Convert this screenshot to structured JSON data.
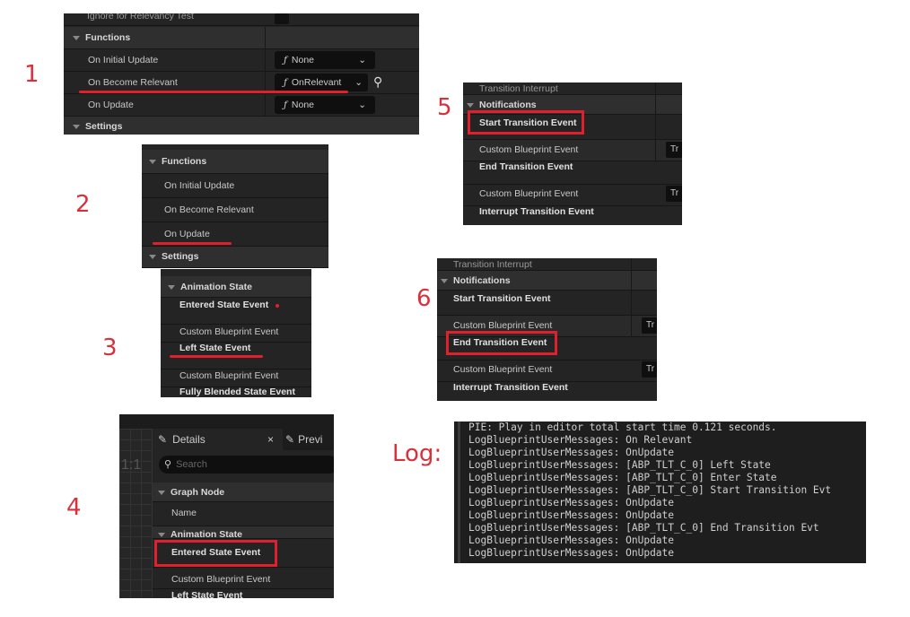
{
  "labels": {
    "p1": "1",
    "p2": "2",
    "p3": "3",
    "p4": "4",
    "p5": "5",
    "p6": "6",
    "log": "Log:"
  },
  "panel1": {
    "partial_row": "Ignore for Relevancy Test",
    "section": "Functions",
    "rows": [
      {
        "label": "On Initial Update",
        "value": "None"
      },
      {
        "label": "On Become Relevant",
        "value": "OnRelevant"
      },
      {
        "label": "On Update",
        "value": "None"
      }
    ],
    "next_section": "Settings",
    "func_icon": "ƒ"
  },
  "panel2": {
    "section": "Functions",
    "rows": [
      "On Initial Update",
      "On Become Relevant",
      "On Update"
    ],
    "next_section": "Settings"
  },
  "panel3": {
    "section": "Animation State",
    "rows": [
      "Entered State Event",
      "Custom Blueprint Event",
      "Left State Event",
      "Custom Blueprint Event",
      "Fully Blended State Event"
    ]
  },
  "panel4": {
    "tab_details": "Details",
    "tab_close": "×",
    "tab_preview": "Previ",
    "zoom_label": "1:1",
    "search_placeholder": "Search",
    "section1": "Graph Node",
    "name_row": "Name",
    "section2": "Animation State",
    "rows": [
      "Entered State Event",
      "Custom Blueprint Event",
      "Left State Event"
    ]
  },
  "panel5": {
    "partial": "Transition Interrupt",
    "section": "Notifications",
    "rows": [
      "Start Transition Event",
      "Custom Blueprint Event",
      "End Transition Event",
      "Custom Blueprint Event",
      "Interrupt Transition Event"
    ],
    "value_prefix": "Tr"
  },
  "panel6": {
    "partial": "Transition Interrupt",
    "section": "Notifications",
    "rows": [
      "Start Transition Event",
      "Custom Blueprint Event",
      "End Transition Event",
      "Custom Blueprint Event",
      "Interrupt Transition Event"
    ],
    "value_prefix": "Tr"
  },
  "log": [
    "PIE: Play in editor total start time 0.121 seconds.",
    "LogBlueprintUserMessages: On Relevant",
    "LogBlueprintUserMessages: OnUpdate",
    "LogBlueprintUserMessages: [ABP_TLT_C_0] Left State",
    "LogBlueprintUserMessages: [ABP_TLT_C_0] Enter State",
    "LogBlueprintUserMessages: [ABP_TLT_C_0] Start Transition Evt",
    "LogBlueprintUserMessages: OnUpdate",
    "LogBlueprintUserMessages: OnUpdate",
    "LogBlueprintUserMessages: [ABP_TLT_C_0] End Transition Evt",
    "LogBlueprintUserMessages: OnUpdate",
    "LogBlueprintUserMessages: OnUpdate"
  ],
  "colors": {
    "annotation": "#e0202c",
    "panel_bg": "#242424",
    "header_bg": "#2f2f2f"
  }
}
